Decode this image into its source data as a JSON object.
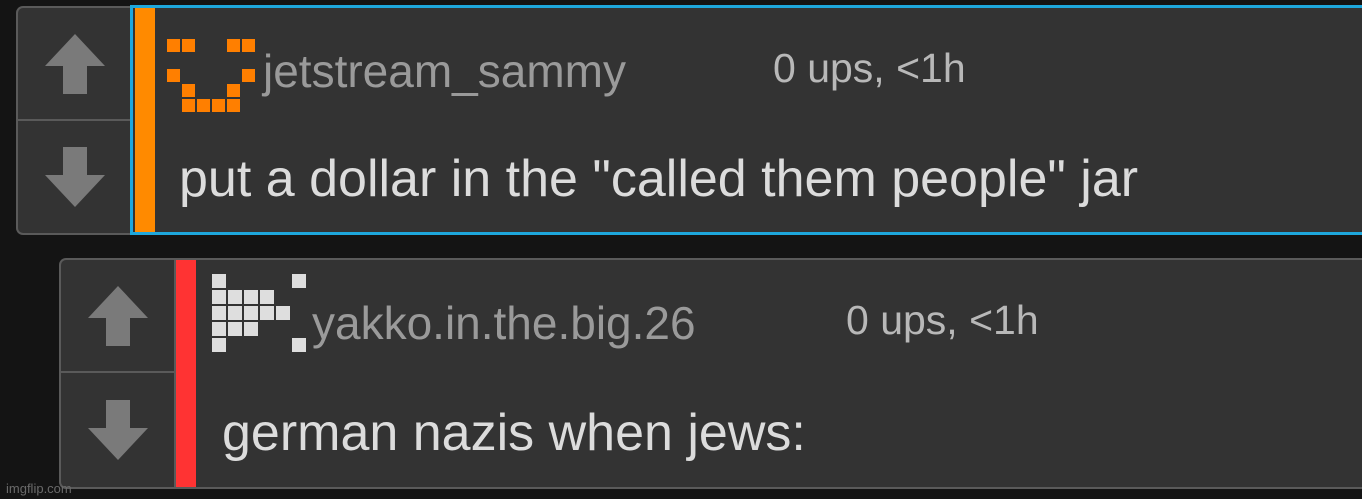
{
  "comments": [
    {
      "username": "jetstream_sammy",
      "meta": "0 ups, <1h",
      "text": "put a dollar in the \"called them people\" jar",
      "bar_color": "#ff8a00",
      "highlighted": true,
      "avatar_color": "#ff7f00",
      "avatar_icon": "pixel-identicon"
    },
    {
      "username": "yakko.in.the.big.26",
      "meta": "0 ups, <1h",
      "text": "german nazis when jews:",
      "bar_color": "#ff3333",
      "highlighted": false,
      "avatar_color": "#dedede",
      "avatar_icon": "pixel-identicon"
    }
  ],
  "watermark": "imgflip.com",
  "colors": {
    "background": "#141414",
    "panel": "#333333",
    "highlight": "#1ea7dc",
    "arrow": "#7a7a7a"
  }
}
